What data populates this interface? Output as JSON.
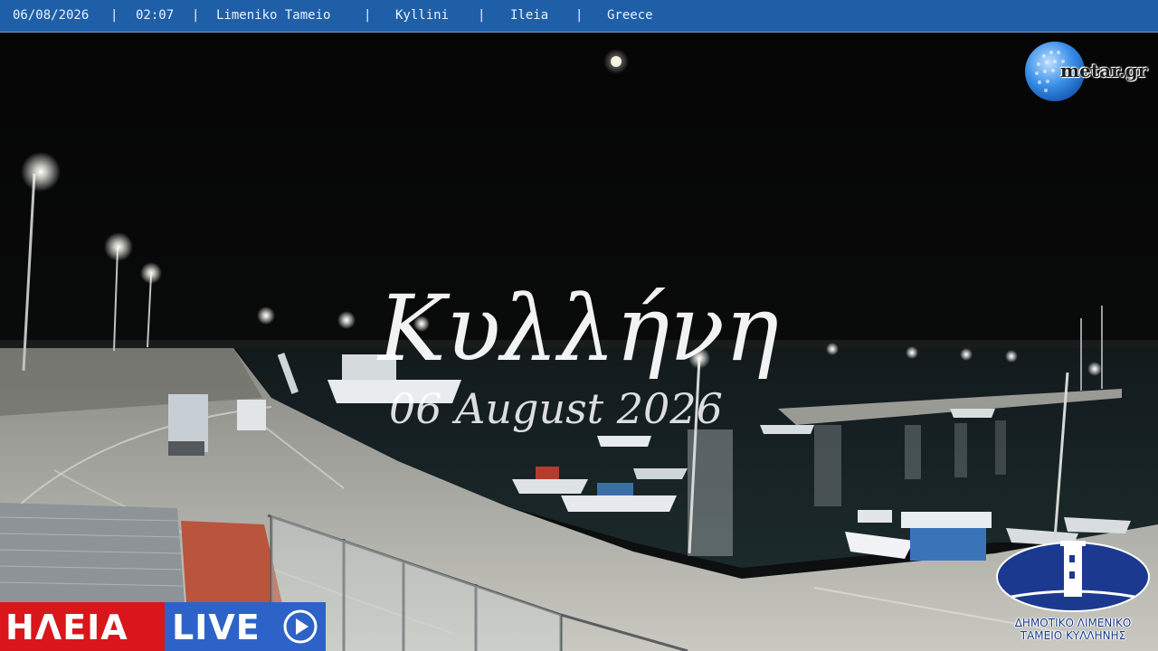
{
  "overlay": {
    "date": "06/08/2026",
    "time": "02:07",
    "location": "Limeniko Tameio",
    "town": "Kyllini",
    "region": "Ileia",
    "country": "Greece",
    "separator": "|"
  },
  "brand": {
    "metar_text": "metar.gr",
    "title_script": "Κυλλήνη",
    "subtitle_script": "06 August 2026",
    "ileia_text": "ΗΛΕΙΑ",
    "live_text": "LIVE",
    "port_line1": "ΔΗΜΟΤΙΚΟ ΛΙΜΕΝΙΚΟ",
    "port_line2": "ΤΑΜΕΙΟ ΚΥΛΛΗΝΗΣ"
  },
  "icons": {
    "globe": "globe-icon",
    "play": "play-icon",
    "lighthouse": "lighthouse-icon"
  },
  "colors": {
    "topbar": "#1f5fa8",
    "ileia_red": "#d8161c",
    "live_blue": "#2d63c8",
    "port_navy": "#1b3a8f"
  }
}
